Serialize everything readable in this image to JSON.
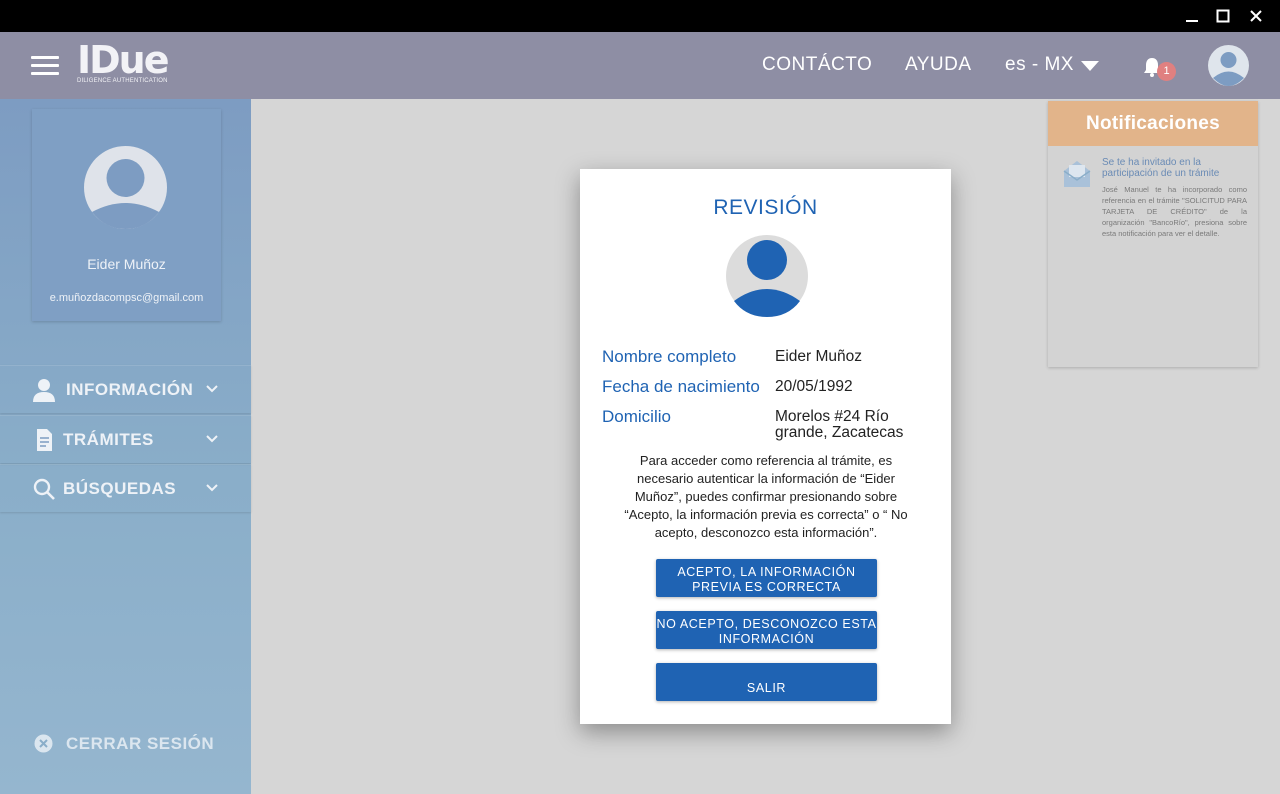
{
  "window": {
    "minimize_glyph": "—",
    "maximize_glyph": "☐",
    "close_glyph": "✕"
  },
  "header": {
    "logo_text": "IDue",
    "logo_subtitle": "DILIGENCE AUTHENTICATION",
    "nav_contacto": "CONTÁCTO",
    "nav_ayuda": "AYUDA",
    "language": "es - MX",
    "notification_count": "1",
    "icons": [
      "hamburger-menu-icon",
      "bell-icon",
      "user-avatar-icon",
      "caret-down-icon"
    ]
  },
  "sidebar": {
    "profile": {
      "name": "Eider Muñoz",
      "email": "e.muñozdacompsc@gmail.com"
    },
    "items": [
      {
        "label": "INFORMACIÓN",
        "icon": "user-icon"
      },
      {
        "label": "TRÁMITES",
        "icon": "document-icon"
      },
      {
        "label": "BÚSQUEDAS",
        "icon": "search-icon"
      }
    ],
    "logout": "CERRAR SESIÓN"
  },
  "notifications": {
    "title": "Notificaciones",
    "items": [
      {
        "title": "Se te ha invitado en la participación de un trámite",
        "body": "José Manuel te ha incorporado como referencia en el trámite \"SOLICITUD PARA TARJETA DE CRÉDITO\" de la organización \"BancoRío\", presiona sobre esta notificación para ver el detalle.",
        "icon": "envelope-icon"
      }
    ]
  },
  "modal": {
    "title": "REVISIÓN",
    "fields": [
      {
        "label": "Nombre completo",
        "value": "Eider Muñoz"
      },
      {
        "label": "Fecha de nacimiento",
        "value": "20/05/1992"
      },
      {
        "label": "Domicilio",
        "value": "Morelos #24 Río grande, Zacatecas"
      }
    ],
    "message": "Para acceder como referencia al trámite, es necesario autenticar la información de “Eider Muñoz”, puedes confirmar presionando sobre “Acepto, la información previa es correcta” o “ No acepto, desconozco esta información”.",
    "buttons": {
      "accept": "ACEPTO, LA INFORMACIÓN PREVIA ES CORRECTA",
      "reject": "NO ACEPTO, DESCONOZCO ESTA INFORMACIÓN",
      "exit": "SALIR"
    }
  },
  "colors": {
    "primary": "#1f63b3",
    "appbar": "#8e8ea4",
    "sidebar": "#7d9cc2",
    "notification_header": "#e2b48a",
    "badge": "#e08080"
  }
}
